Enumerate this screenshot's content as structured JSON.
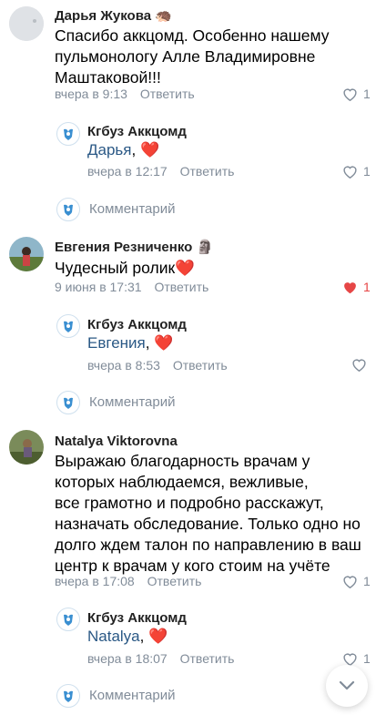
{
  "comments": [
    {
      "author": "Дарья Жукова",
      "badge": "🦔",
      "text_lines": [
        "Спасибо аккцомд. Особенно нашему",
        "пульмонологу Алле Владимировне",
        "Маштаковой!!!"
      ],
      "date": "вчера в 9:13",
      "reply_label": "Ответить",
      "likes": "1",
      "liked": false,
      "reply": {
        "author": "Кгбуз Аккцомд",
        "mention": "Дарья",
        "suffix": ", ❤️",
        "date": "вчера в 12:17",
        "reply_label": "Ответить",
        "likes": "1"
      },
      "comment_placeholder": "Комментарий"
    },
    {
      "author": "Евгения Резниченко",
      "badge": "🗿",
      "text_lines": [
        "Чудесный ролик❤️"
      ],
      "date": "9 июня в 17:31",
      "reply_label": "Ответить",
      "likes": "1",
      "liked": true,
      "reply": {
        "author": "Кгбуз Аккцомд",
        "mention": "Евгения",
        "suffix": ", ❤️",
        "date": "вчера в 8:53",
        "reply_label": "Ответить",
        "likes": ""
      },
      "comment_placeholder": "Комментарий"
    },
    {
      "author": "Natalya Viktorovna",
      "badge": "",
      "text_lines": [
        "Выражаю благодарность врачам у",
        "которых наблюдаемся, вежливые,",
        "все грамотно и подробно расскажут,",
        "назначать обследование. Только одно но",
        "долго ждем талон по направлению в ваш",
        "центр к врачам у кого стоим на учёте"
      ],
      "date": "вчера в 17:08",
      "reply_label": "Ответить",
      "likes": "1",
      "liked": false,
      "reply": {
        "author": "Кгбуз Аккцомд",
        "mention": "Natalya",
        "suffix": ", ❤️",
        "date": "вчера в 18:07",
        "reply_label": "Ответить",
        "likes": "1"
      },
      "comment_placeholder": "Комментарий"
    }
  ],
  "colors": {
    "link": "#2a5885",
    "meta": "#818c99",
    "like_active": "#e64646"
  },
  "icons": {
    "like": "heart-outline-icon",
    "liked": "heart-filled-icon",
    "scroll": "chevron-down-icon"
  }
}
